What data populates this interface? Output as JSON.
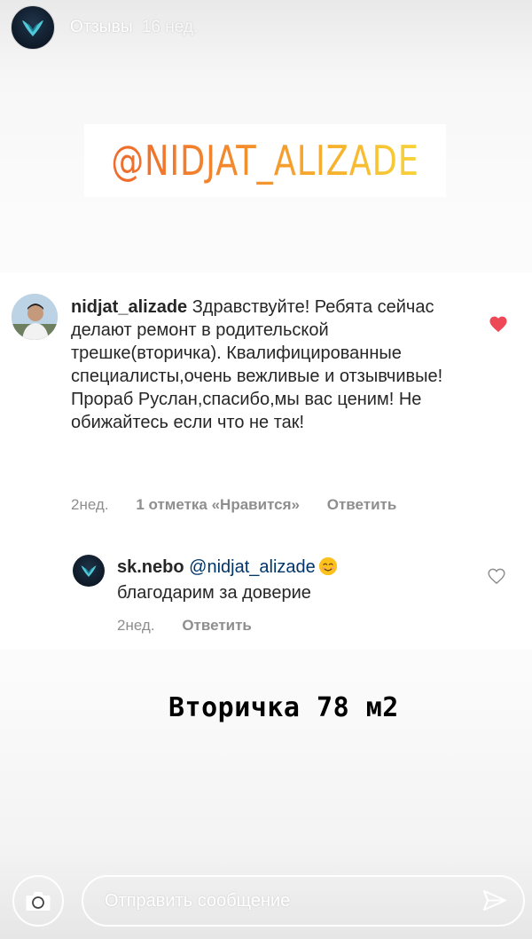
{
  "header": {
    "title": "Отзывы",
    "time": "16 нед."
  },
  "banner": {
    "handle": "@NIDJAT_ALIZADE"
  },
  "comment": {
    "username": "nidjat_alizade",
    "text": "Здравствуйте! Ребята сейчас делают ремонт в родительской трешке(вторичка). Квалифицированные специалисты,очень вежливые и отзывчивые!Прораб Руслан,спасибо,мы вас ценим! Не обижайтесь если что не так!",
    "time": "2нед.",
    "likes": "1 отметка «Нравится»",
    "reply_label": "Ответить",
    "liked": true
  },
  "reply": {
    "username": "sk.nebo",
    "mention": "@nidjat_alizade",
    "emoji": "smiling-face-emoji",
    "text": "благодарим за доверие",
    "time": "2нед.",
    "reply_label": "Ответить",
    "liked": false
  },
  "caption": "Вторичка 78 м2",
  "bottom_bar": {
    "message_placeholder": "Отправить сообщение",
    "camera_icon": "camera-icon",
    "send_icon": "paper-plane-icon"
  },
  "colors": {
    "heart_liked": "#ed4956",
    "mention": "#003569",
    "meta_gray": "#8e8e8e",
    "banner_gradient_start": "#ef6a2c",
    "banner_gradient_end": "#f8d33a"
  }
}
